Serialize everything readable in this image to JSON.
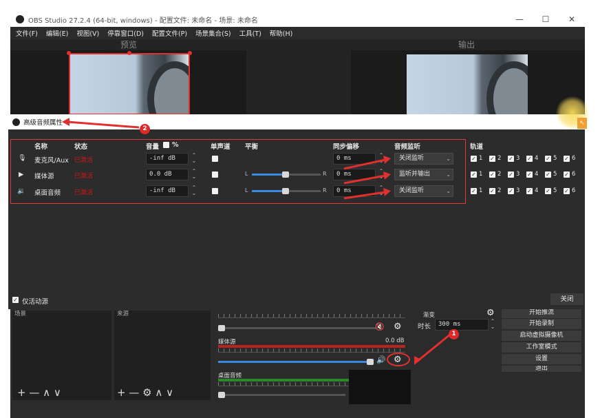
{
  "window": {
    "title": "OBS Studio 27.2.4 (64-bit, windows) - 配置文件: 未命名 - 场景: 未命名",
    "min": "—",
    "max": "☐",
    "close": "✕"
  },
  "menu": [
    "文件(F)",
    "编辑(E)",
    "视图(V)",
    "停靠窗口(D)",
    "配置文件(P)",
    "场景集合(S)",
    "工具(T)",
    "帮助(H)"
  ],
  "preview_label": "预览",
  "output_label": "输出",
  "dialog": {
    "title": "高级音频属性",
    "headers": {
      "name": "名称",
      "status": "状态",
      "volume": "音量",
      "percent": "%",
      "mono": "单声道",
      "balance": "平衡",
      "sync": "同步偏移",
      "monitor": "音频监听",
      "tracks": "轨道"
    },
    "rows": [
      {
        "icon": "microphone-icon",
        "name": "麦克风/Aux",
        "status": "已激活",
        "volume": "-inf dB",
        "sync": "0 ms",
        "monitor": "关闭监听",
        "balance": null,
        "tracks": [
          "1",
          "2",
          "3",
          "4",
          "5",
          "6"
        ]
      },
      {
        "icon": "play-icon",
        "name": "媒体源",
        "status": "已激活",
        "volume": "0.0 dB",
        "sync": "0 ms",
        "monitor": "监听并输出",
        "balance": 0.5,
        "tracks": [
          "1",
          "2",
          "3",
          "4",
          "5",
          "6"
        ]
      },
      {
        "icon": "speaker-icon",
        "name": "桌面音频",
        "status": "已激活",
        "volume": "-inf dB",
        "sync": "0 ms",
        "monitor": "关闭监听",
        "balance": 0.5,
        "tracks": [
          "1",
          "2",
          "3",
          "4",
          "5",
          "6"
        ]
      }
    ],
    "balance_left": "L",
    "balance_right": "R",
    "only_active": "仅活动源",
    "close_label": "关闭"
  },
  "lower": {
    "scenes_head": "场景",
    "sources_head": "来源",
    "dock_controls": "+ — ∧ ∨",
    "source_controls": "+ — ⚙ ∧ ∨",
    "mixer": [
      {
        "name": "",
        "db": "",
        "muted": true
      },
      {
        "name": "媒体源",
        "db": "0.0 dB",
        "muted": false
      },
      {
        "name": "桌面音频",
        "db": "",
        "muted": false
      }
    ],
    "transition_label": "渐变",
    "duration_label": "时长",
    "duration_value": "300 ms",
    "controls": [
      "开始推流",
      "开始录制",
      "启动虚拟摄像机",
      "工作室模式",
      "设置",
      "退出"
    ]
  },
  "annotations": {
    "badge1": "1",
    "badge2": "2"
  }
}
